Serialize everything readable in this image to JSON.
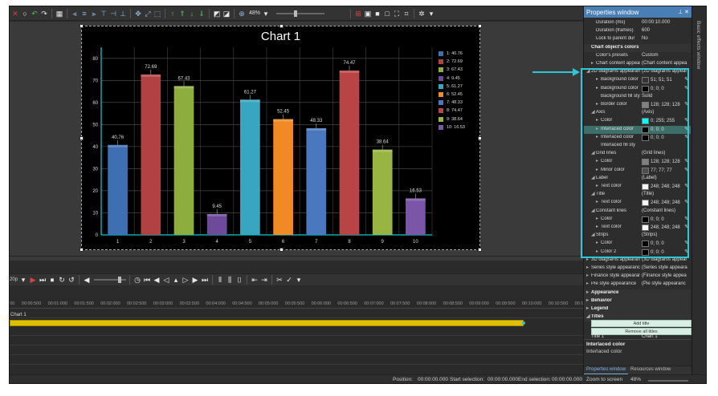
{
  "toolbar": {
    "zoom": "48%"
  },
  "chart_data": {
    "type": "bar",
    "title": "Chart 1",
    "categories": [
      "1",
      "2",
      "3",
      "4",
      "5",
      "6",
      "7",
      "8",
      "9",
      "10"
    ],
    "values": [
      40.76,
      72.69,
      67.43,
      9.45,
      61.27,
      52.45,
      48.33,
      74.47,
      38.64,
      16.53
    ],
    "value_labels": [
      "40.76",
      "72.69",
      "67.43",
      "9.45",
      "61.27",
      "52.45",
      "48.33",
      "74.47",
      "38.64",
      "16.53"
    ],
    "colors": [
      "#3d6fb3",
      "#b24142",
      "#8ead3f",
      "#6e4a9a",
      "#38a6c0",
      "#f08a24",
      "#4a78bf",
      "#b84446",
      "#98b543",
      "#7a55a8"
    ],
    "yticks": [
      "0",
      "10",
      "20",
      "30",
      "40",
      "50",
      "60",
      "70",
      "80"
    ],
    "ylim": [
      0,
      85
    ],
    "legend": [
      "1: 40.76",
      "2: 72.69",
      "3: 67.43",
      "4: 9.45",
      "5: 61.27",
      "6: 52.45",
      "7: 48.33",
      "8: 74.47",
      "9: 38.64",
      "10: 16.53"
    ],
    "legend_position": "right",
    "grid": true
  },
  "timeline": {
    "ruler": [
      "00:00:000",
      "00:00:500",
      "00:01:000",
      "00:01:500",
      "00:02:000",
      "00:02:500",
      "00:03:000",
      "00:03:500",
      "00:04:000",
      "00:04:500",
      "00:05:000",
      "00:05:500",
      "00:06:000",
      "00:06:500",
      "00:07:000",
      "00:07:500",
      "00:08:000",
      "00:08:500",
      "00:09:000",
      "00:09:500",
      "00:10:000",
      "00:10:500",
      "00:11:000"
    ],
    "clip_label": "Chart 1",
    "fps": "20p"
  },
  "status": {
    "position_label": "Position:",
    "position_value": "00:00:00.000",
    "start_label": "Start selection:",
    "start_value": "00:00:00.000",
    "end_label": "End selection:",
    "end_value": "00:00:00.000",
    "zoom_label": "Zoom to screen",
    "zoom_value": "48%"
  },
  "properties": {
    "title": "Properties window",
    "rows": [
      {
        "name": "Duration (ms)",
        "value": "00:00:10.000",
        "indent": 1
      },
      {
        "name": "Duration (frames)",
        "value": "600",
        "indent": 1
      },
      {
        "name": "Lock to parent dur",
        "value": "No",
        "indent": 1
      },
      {
        "name": "Chart object's colors",
        "value": "",
        "indent": 0,
        "section": true
      },
      {
        "name": "Color's presets",
        "value": "Custom",
        "indent": 1
      },
      {
        "name": "Chart content appear",
        "value": "(Chart content appea",
        "indent": 1,
        "exp": "▸"
      },
      {
        "name": "2D diagrams appearan",
        "value": "(2D diagrams appear",
        "indent": 0,
        "exp": "◢"
      },
      {
        "name": "Background color",
        "value": "51; 51; 51",
        "indent": 2,
        "exp": "▸",
        "swatch": "#333333",
        "pick": true
      },
      {
        "name": "Background color",
        "value": "0; 0; 0",
        "indent": 2,
        "exp": "▸",
        "swatch": "#000000",
        "pick": true
      },
      {
        "name": "Background fill styl",
        "value": "Solid",
        "indent": 2
      },
      {
        "name": "Border color",
        "value": "128; 128; 128",
        "indent": 2,
        "exp": "▸",
        "swatch": "#808080",
        "pick": true
      },
      {
        "name": "Axis",
        "value": "(Axis)",
        "indent": 1,
        "exp": "◢"
      },
      {
        "name": "Color",
        "value": "0; 255; 255",
        "indent": 2,
        "exp": "▸",
        "swatch": "#00ffff",
        "pick": true
      },
      {
        "name": "Interlaced color",
        "value": "0; 0; 0",
        "indent": 2,
        "exp": "▸",
        "swatch": "#000000",
        "pick": true,
        "highlight": true
      },
      {
        "name": "Interlaced color",
        "value": "0; 0; 0",
        "indent": 2,
        "exp": "▸",
        "swatch": "#000000",
        "pick": true
      },
      {
        "name": "Interlaced fill sty",
        "value": "",
        "indent": 2
      },
      {
        "name": "Grid lines",
        "value": "(Grid lines)",
        "indent": 1,
        "exp": "◢"
      },
      {
        "name": "Color",
        "value": "128; 128; 128",
        "indent": 2,
        "exp": "▸",
        "swatch": "#808080",
        "pick": true
      },
      {
        "name": "Minor color",
        "value": "77; 77; 77",
        "indent": 2,
        "exp": "▸",
        "swatch": "#4d4d4d",
        "pick": true
      },
      {
        "name": "Label",
        "value": "(Label)",
        "indent": 1,
        "exp": "◢"
      },
      {
        "name": "Text color",
        "value": "248; 248; 248",
        "indent": 2,
        "exp": "▸",
        "swatch": "#f8f8f8",
        "pick": true
      },
      {
        "name": "Title",
        "value": "(Title)",
        "indent": 1,
        "exp": "◢"
      },
      {
        "name": "Text color",
        "value": "248; 248; 248",
        "indent": 2,
        "exp": "▸",
        "swatch": "#f8f8f8",
        "pick": true
      },
      {
        "name": "Constant lines",
        "value": "(Constant lines)",
        "indent": 1,
        "exp": "◢"
      },
      {
        "name": "Color",
        "value": "0; 0; 0",
        "indent": 2,
        "exp": "▸",
        "swatch": "#000000",
        "pick": true
      },
      {
        "name": "Text color",
        "value": "248; 248; 248",
        "indent": 2,
        "exp": "▸",
        "swatch": "#f8f8f8",
        "pick": true
      },
      {
        "name": "Strips",
        "value": "(Strips)",
        "indent": 1,
        "exp": "◢"
      },
      {
        "name": "Color",
        "value": "0; 0; 0",
        "indent": 2,
        "exp": "▸",
        "swatch": "#000000",
        "pick": true
      },
      {
        "name": "Color 2",
        "value": "0; 0; 0",
        "indent": 2,
        "exp": "▸",
        "swatch": "#000000",
        "pick": true
      },
      {
        "name": "3D diagrams appearan",
        "value": "(3D diagrams appear",
        "indent": 0,
        "exp": "▸"
      },
      {
        "name": "Series style appearanc",
        "value": "(Series style appeara",
        "indent": 0,
        "exp": "▸"
      },
      {
        "name": "Finance style appearan",
        "value": "(Finance style appea",
        "indent": 0,
        "exp": "▸"
      },
      {
        "name": "Pie style appearance",
        "value": "(Pie style appearanc",
        "indent": 0,
        "exp": "▸"
      },
      {
        "name": "Appearance",
        "value": "",
        "indent": 0,
        "exp": "▸",
        "section": true
      },
      {
        "name": "Behavior",
        "value": "",
        "indent": 0,
        "exp": "▸",
        "section": true
      },
      {
        "name": "Legend",
        "value": "",
        "indent": 0,
        "exp": "▸",
        "section": true
      },
      {
        "name": "Titles",
        "value": "",
        "indent": 0,
        "exp": "◢",
        "section": true
      }
    ],
    "add_title": "Add title",
    "remove_titles": "Remove all titles",
    "titles_row": "Title 1",
    "titles_value": "Chart 1",
    "desc_title": "Interlaced color",
    "desc_text": "Interlaced color",
    "tab_properties": "Properties window",
    "tab_resources": "Resources window"
  },
  "side_panel": {
    "label": "Basic effects window"
  },
  "annotation": {
    "highlight_color": "#2cc8d8"
  }
}
